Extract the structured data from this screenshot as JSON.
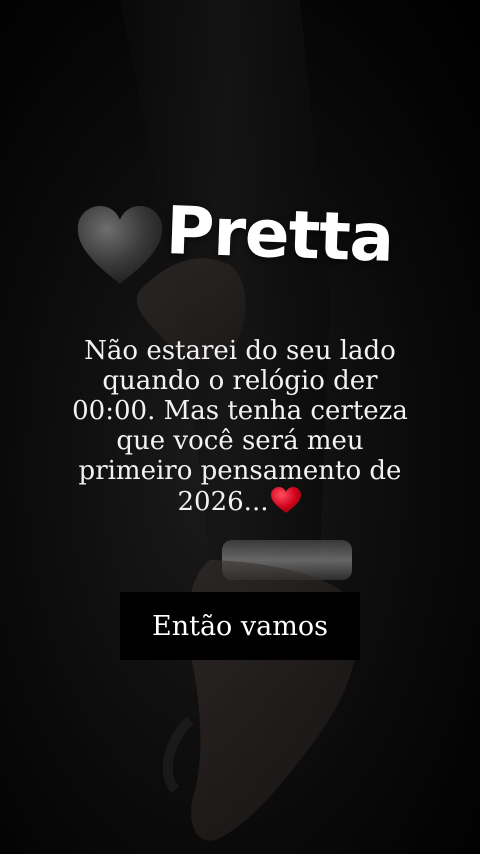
{
  "title": {
    "text": "Pretta",
    "heart_icon": "black-heart-icon"
  },
  "message": {
    "lines": [
      "Não estarei do seu lado",
      "quando o relógio der",
      "00:00. Mas tenha certeza",
      "que você será meu",
      "primeiro pensamento de",
      "2026..."
    ],
    "end_icon": "red-heart-icon"
  },
  "caption": {
    "text": "Então vamos"
  },
  "colors": {
    "background": "#000000",
    "text": "#ffffff",
    "heart_red": "#d0021b"
  }
}
